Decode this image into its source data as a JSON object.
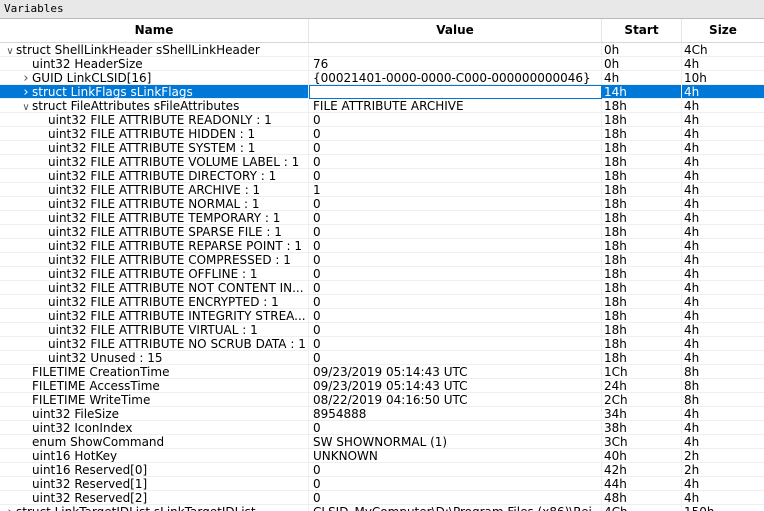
{
  "window": {
    "title": "Variables"
  },
  "columns": {
    "name": "Name",
    "value": "Value",
    "start": "Start",
    "size": "Size"
  },
  "rows": [
    {
      "level": 0,
      "expander": "open",
      "name": "struct ShellLinkHeader sShellLinkHeader",
      "value": "",
      "start": "0h",
      "size": "4Ch"
    },
    {
      "level": 1,
      "expander": "none",
      "name": "uint32 HeaderSize",
      "value": "76",
      "start": "0h",
      "size": "4h"
    },
    {
      "level": 1,
      "expander": "closed",
      "name": "GUID LinkCLSID[16]",
      "value": "{00021401-0000-0000-C000-000000000046}",
      "start": "4h",
      "size": "10h"
    },
    {
      "level": 1,
      "expander": "closed",
      "name": "struct LinkFlags sLinkFlags",
      "value": "",
      "start": "14h",
      "size": "4h",
      "selected": true
    },
    {
      "level": 1,
      "expander": "open",
      "name": "struct FileAttributes sFileAttributes",
      "value": "FILE ATTRIBUTE ARCHIVE",
      "start": "18h",
      "size": "4h"
    },
    {
      "level": 2,
      "expander": "none",
      "name": "uint32 FILE ATTRIBUTE READONLY : 1",
      "value": "0",
      "start": "18h",
      "size": "4h"
    },
    {
      "level": 2,
      "expander": "none",
      "name": "uint32 FILE ATTRIBUTE HIDDEN : 1",
      "value": "0",
      "start": "18h",
      "size": "4h"
    },
    {
      "level": 2,
      "expander": "none",
      "name": "uint32 FILE ATTRIBUTE SYSTEM : 1",
      "value": "0",
      "start": "18h",
      "size": "4h"
    },
    {
      "level": 2,
      "expander": "none",
      "name": "uint32 FILE ATTRIBUTE VOLUME LABEL : 1",
      "value": "0",
      "start": "18h",
      "size": "4h"
    },
    {
      "level": 2,
      "expander": "none",
      "name": "uint32 FILE ATTRIBUTE DIRECTORY : 1",
      "value": "0",
      "start": "18h",
      "size": "4h"
    },
    {
      "level": 2,
      "expander": "none",
      "name": "uint32 FILE ATTRIBUTE ARCHIVE : 1",
      "value": "1",
      "start": "18h",
      "size": "4h"
    },
    {
      "level": 2,
      "expander": "none",
      "name": "uint32 FILE ATTRIBUTE NORMAL : 1",
      "value": "0",
      "start": "18h",
      "size": "4h"
    },
    {
      "level": 2,
      "expander": "none",
      "name": "uint32 FILE ATTRIBUTE TEMPORARY : 1",
      "value": "0",
      "start": "18h",
      "size": "4h"
    },
    {
      "level": 2,
      "expander": "none",
      "name": "uint32 FILE ATTRIBUTE SPARSE FILE : 1",
      "value": "0",
      "start": "18h",
      "size": "4h"
    },
    {
      "level": 2,
      "expander": "none",
      "name": "uint32 FILE ATTRIBUTE REPARSE POINT : 1",
      "value": "0",
      "start": "18h",
      "size": "4h"
    },
    {
      "level": 2,
      "expander": "none",
      "name": "uint32 FILE ATTRIBUTE COMPRESSED : 1",
      "value": "0",
      "start": "18h",
      "size": "4h"
    },
    {
      "level": 2,
      "expander": "none",
      "name": "uint32 FILE ATTRIBUTE OFFLINE : 1",
      "value": "0",
      "start": "18h",
      "size": "4h"
    },
    {
      "level": 2,
      "expander": "none",
      "name": "uint32 FILE ATTRIBUTE NOT CONTENT IN...",
      "value": "0",
      "start": "18h",
      "size": "4h"
    },
    {
      "level": 2,
      "expander": "none",
      "name": "uint32 FILE ATTRIBUTE ENCRYPTED : 1",
      "value": "0",
      "start": "18h",
      "size": "4h"
    },
    {
      "level": 2,
      "expander": "none",
      "name": "uint32 FILE ATTRIBUTE INTEGRITY STREA...",
      "value": "0",
      "start": "18h",
      "size": "4h"
    },
    {
      "level": 2,
      "expander": "none",
      "name": "uint32 FILE ATTRIBUTE VIRTUAL : 1",
      "value": "0",
      "start": "18h",
      "size": "4h"
    },
    {
      "level": 2,
      "expander": "none",
      "name": "uint32 FILE ATTRIBUTE NO SCRUB DATA : 1",
      "value": "0",
      "start": "18h",
      "size": "4h"
    },
    {
      "level": 2,
      "expander": "none",
      "name": "uint32 Unused : 15",
      "value": "0",
      "start": "18h",
      "size": "4h"
    },
    {
      "level": 1,
      "expander": "none",
      "name": "FILETIME CreationTime",
      "value": "09/23/2019 05:14:43 UTC",
      "start": "1Ch",
      "size": "8h"
    },
    {
      "level": 1,
      "expander": "none",
      "name": "FILETIME AccessTime",
      "value": "09/23/2019 05:14:43 UTC",
      "start": "24h",
      "size": "8h"
    },
    {
      "level": 1,
      "expander": "none",
      "name": "FILETIME WriteTime",
      "value": "08/22/2019 04:16:50 UTC",
      "start": "2Ch",
      "size": "8h"
    },
    {
      "level": 1,
      "expander": "none",
      "name": "uint32 FileSize",
      "value": "8954888",
      "start": "34h",
      "size": "4h"
    },
    {
      "level": 1,
      "expander": "none",
      "name": "uint32 IconIndex",
      "value": "0",
      "start": "38h",
      "size": "4h"
    },
    {
      "level": 1,
      "expander": "none",
      "name": "enum ShowCommand",
      "value": "SW SHOWNORMAL (1)",
      "start": "3Ch",
      "size": "4h"
    },
    {
      "level": 1,
      "expander": "none",
      "name": "uint16 HotKey",
      "value": "UNKNOWN",
      "start": "40h",
      "size": "2h"
    },
    {
      "level": 1,
      "expander": "none",
      "name": "uint16 Reserved[0]",
      "value": "0",
      "start": "42h",
      "size": "2h"
    },
    {
      "level": 1,
      "expander": "none",
      "name": "uint32 Reserved[1]",
      "value": "0",
      "start": "44h",
      "size": "4h"
    },
    {
      "level": 1,
      "expander": "none",
      "name": "uint32 Reserved[2]",
      "value": "0",
      "start": "48h",
      "size": "4h"
    },
    {
      "level": 0,
      "expander": "closed",
      "name": "struct LinkTargetIDList sLinkTargetIDList",
      "value": "CLSID_MyComputer\\D:\\Program Files (x86)\\Rei...",
      "start": "4Ch",
      "size": "150h"
    }
  ]
}
